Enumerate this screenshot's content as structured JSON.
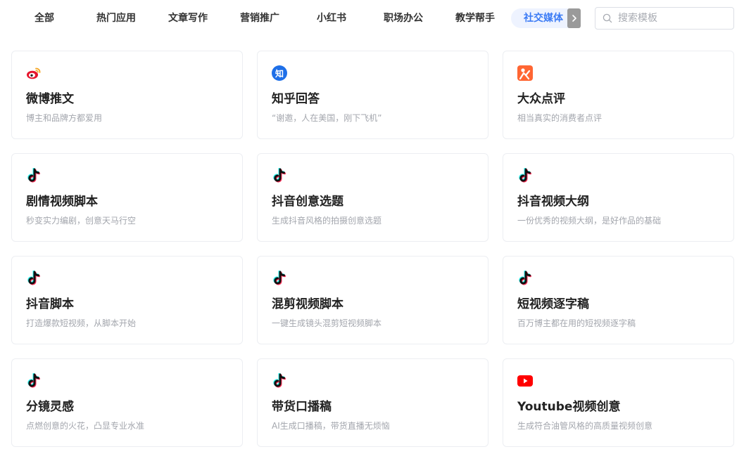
{
  "tabs": [
    {
      "label": "全部",
      "active": false
    },
    {
      "label": "热门应用",
      "active": false
    },
    {
      "label": "文章写作",
      "active": false
    },
    {
      "label": "营销推广",
      "active": false
    },
    {
      "label": "小红书",
      "active": false
    },
    {
      "label": "职场办公",
      "active": false
    },
    {
      "label": "教学帮手",
      "active": false
    },
    {
      "label": "社交媒体",
      "active": true
    }
  ],
  "search": {
    "placeholder": "搜索模板",
    "value": ""
  },
  "cards": [
    {
      "icon": "weibo-icon",
      "title": "微博推文",
      "desc": "博主和品牌方都爱用"
    },
    {
      "icon": "zhihu-icon",
      "title": "知乎回答",
      "desc": "“谢邀，人在美国，刚下飞机”",
      "icon_text": "知"
    },
    {
      "icon": "dianping-icon",
      "title": "大众点评",
      "desc": "相当真实的消费者点评"
    },
    {
      "icon": "douyin-icon",
      "title": "剧情视频脚本",
      "desc": "秒变实力编剧，创意天马行空"
    },
    {
      "icon": "douyin-icon",
      "title": "抖音创意选题",
      "desc": "生成抖音风格的拍摄创意选题"
    },
    {
      "icon": "douyin-icon",
      "title": "抖音视频大纲",
      "desc": "一份优秀的视频大纲，是好作品的基础"
    },
    {
      "icon": "douyin-icon",
      "title": "抖音脚本",
      "desc": "打造爆款短视频，从脚本开始"
    },
    {
      "icon": "douyin-icon",
      "title": "混剪视频脚本",
      "desc": "一键生成镜头混剪短视频脚本"
    },
    {
      "icon": "douyin-icon",
      "title": "短视频逐字稿",
      "desc": "百万博主都在用的短视频逐字稿"
    },
    {
      "icon": "douyin-icon",
      "title": "分镜灵感",
      "desc": "点燃创意的火花，凸显专业水准"
    },
    {
      "icon": "douyin-icon",
      "title": "带货口播稿",
      "desc": "AI生成口播稿，带货直播无烦恼"
    },
    {
      "icon": "youtube-icon",
      "title": "Youtube视频创意",
      "desc": "生成符合油管风格的高质量视频创意"
    }
  ],
  "colors": {
    "accent": "#3b7bf5",
    "weibo": "#e6162d",
    "zhihu": "#1e6fe8",
    "dianping": "#ff6633",
    "youtube": "#ff0000"
  }
}
